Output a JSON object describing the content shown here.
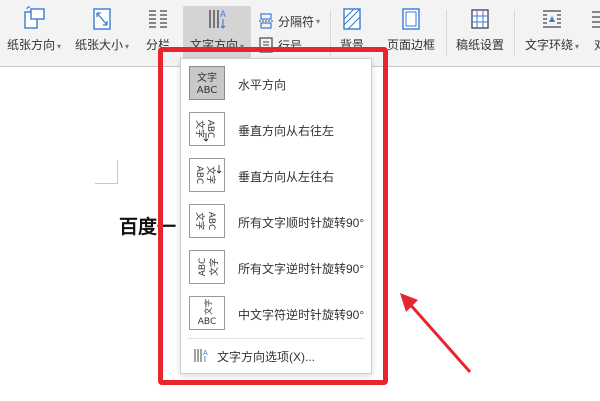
{
  "ribbon": {
    "paper_direction": "纸张方向",
    "paper_size": "纸张大小",
    "columns": "分栏",
    "text_direction": "文字方向",
    "separator": "分隔符",
    "line_number": "行号",
    "background": "背景",
    "page_border": "页面边框",
    "draft_paper": "稿纸设置",
    "text_wrap": "文字环绕",
    "align_partial": "对"
  },
  "document": {
    "text": "百度一"
  },
  "menu": {
    "items": [
      {
        "label": "水平方向",
        "icon": "horizontal-text-icon",
        "selected": true
      },
      {
        "label": "垂直方向从右往左",
        "icon": "vertical-rtl-icon"
      },
      {
        "label": "垂直方向从左往右",
        "icon": "vertical-ltr-icon"
      },
      {
        "label": "所有文字顺时针旋转90°",
        "icon": "rotate-cw-icon"
      },
      {
        "label": "所有文字逆时针旋转90°",
        "icon": "rotate-ccw-icon"
      },
      {
        "label": "中文字符逆时针旋转90°",
        "icon": "cjk-rotate-ccw-icon"
      }
    ],
    "options_label": "文字方向选项(X)...",
    "icon_text_cn": "文字",
    "icon_text_en": "ABC"
  },
  "colors": {
    "highlight_red": "#e8242c",
    "menu_selected": "#c8c8c8"
  }
}
